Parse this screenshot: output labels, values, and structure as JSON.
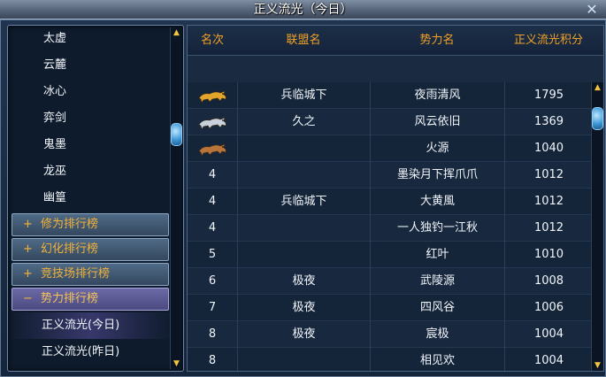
{
  "window": {
    "title": "正义流光（今日）"
  },
  "sidebar": {
    "items_top": [
      {
        "label": "太虚"
      },
      {
        "label": "云麓"
      },
      {
        "label": "冰心"
      },
      {
        "label": "弈剑"
      },
      {
        "label": "鬼墨"
      },
      {
        "label": "龙巫"
      },
      {
        "label": "幽篁"
      }
    ],
    "categories": [
      {
        "sign": "+",
        "label": "修为排行榜"
      },
      {
        "sign": "+",
        "label": "幻化排行榜"
      },
      {
        "sign": "+",
        "label": "竞技场排行榜"
      },
      {
        "sign": "−",
        "label": "势力排行榜"
      }
    ],
    "sub_items": [
      {
        "label": "正义流光(今日)"
      },
      {
        "label": "正义流光(昨日)"
      }
    ]
  },
  "table": {
    "headers": {
      "rank": "名次",
      "union": "联盟名",
      "faction": "势力名",
      "score": "正义流光积分"
    },
    "rows": [
      {
        "rank": "",
        "medal": "gold-beast",
        "union": "兵临城下",
        "faction": "夜雨清风",
        "score": "1795"
      },
      {
        "rank": "",
        "medal": "silver-beast",
        "union": "久之",
        "faction": "风云依旧",
        "score": "1369"
      },
      {
        "rank": "",
        "medal": "bronze-beast",
        "union": "",
        "faction": "火源",
        "score": "1040"
      },
      {
        "rank": "4",
        "union": "",
        "faction": "墨染月下挥爪爪",
        "score": "1012"
      },
      {
        "rank": "4",
        "union": "兵临城下",
        "faction": "大黄風",
        "score": "1012"
      },
      {
        "rank": "4",
        "union": "",
        "faction": "一人独钓一江秋",
        "score": "1012"
      },
      {
        "rank": "5",
        "union": "",
        "faction": "红叶",
        "score": "1010"
      },
      {
        "rank": "6",
        "union": "极夜",
        "faction": "武陵源",
        "score": "1008"
      },
      {
        "rank": "7",
        "union": "极夜",
        "faction": "四风谷",
        "score": "1006"
      },
      {
        "rank": "8",
        "union": "极夜",
        "faction": "宸极",
        "score": "1004"
      },
      {
        "rank": "8",
        "union": "",
        "faction": "相见欢",
        "score": "1004"
      }
    ]
  },
  "colors": {
    "header_text": "#f2a326",
    "category_text": "#f2b23a",
    "gold": "#e0a52a",
    "silver": "#c9d2dc",
    "bronze": "#b8743a"
  },
  "icons": {
    "close": "close-icon",
    "scroll_up": "up-arrow-icon",
    "scroll_down": "down-arrow-icon"
  }
}
